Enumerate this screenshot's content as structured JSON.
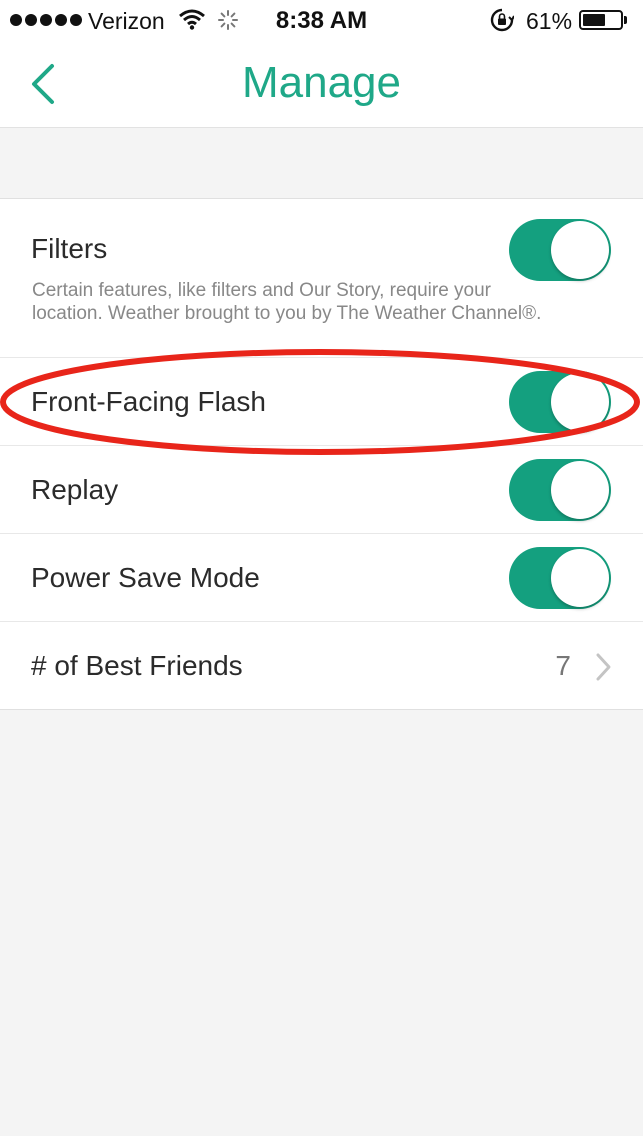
{
  "status_bar": {
    "carrier": "Verizon",
    "time": "8:38 AM",
    "battery_percent": "61%",
    "battery_level": 0.61
  },
  "nav": {
    "title": "Manage",
    "back_icon": "chevron-left-icon"
  },
  "colors": {
    "accent": "#1fa888",
    "toggle_on": "#14a07f",
    "annotation": "#e8251a"
  },
  "settings": {
    "filters": {
      "label": "Filters",
      "description": "Certain features, like filters and Our Story, require your location. Weather brought to you by The Weather Channel®.",
      "enabled": true
    },
    "front_facing_flash": {
      "label": "Front-Facing Flash",
      "enabled": true
    },
    "replay": {
      "label": "Replay",
      "enabled": true
    },
    "power_save": {
      "label": "Power Save Mode",
      "enabled": true
    },
    "best_friends": {
      "label": "# of Best Friends",
      "value": "7"
    }
  }
}
